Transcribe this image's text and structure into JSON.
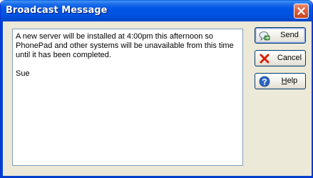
{
  "window": {
    "title": "Broadcast Message"
  },
  "message": {
    "text": "A new server will be installed at 4:00pm this afternoon so PhonePad and other systems will be unavailable from this time until it has been completed.\n\nSue"
  },
  "buttons": {
    "send_label": "Send",
    "cancel_label": "Cancel",
    "help_label_mnemonic": "H",
    "help_label_rest": "elp"
  },
  "icons": {
    "send": "send-message-icon",
    "cancel": "red-x-icon",
    "help": "blue-question-icon",
    "close": "close-icon"
  },
  "colors": {
    "titlebar": "#0055e6",
    "close_button": "#e2613d",
    "dialog_face": "#ece9d8",
    "cancel_icon": "#d81e05",
    "help_icon": "#2a66c6"
  }
}
